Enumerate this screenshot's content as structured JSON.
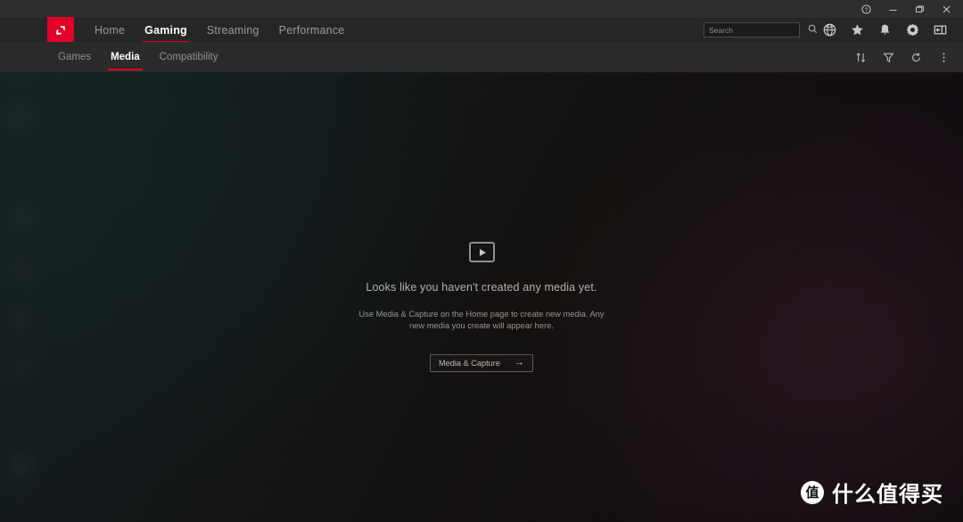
{
  "window": {
    "controls": [
      {
        "name": "help-button",
        "glyph": "?"
      },
      {
        "name": "minimize-button",
        "glyph": "minimize"
      },
      {
        "name": "restore-button",
        "glyph": "restore"
      },
      {
        "name": "close-button",
        "glyph": "close"
      }
    ]
  },
  "brand": {
    "logo_name": "amd-logo",
    "logo_color": "#e00029"
  },
  "mainnav": {
    "items": [
      {
        "label": "Home",
        "active": false
      },
      {
        "label": "Gaming",
        "active": true
      },
      {
        "label": "Streaming",
        "active": false
      },
      {
        "label": "Performance",
        "active": false
      }
    ],
    "accent_color": "#e00029"
  },
  "search": {
    "value": "",
    "placeholder": "Search",
    "icon": "search-icon"
  },
  "toolbar_icons": [
    {
      "name": "globe-icon"
    },
    {
      "name": "star-icon"
    },
    {
      "name": "bell-icon"
    },
    {
      "name": "gear-icon"
    },
    {
      "name": "panel-icon"
    }
  ],
  "subnav": {
    "items": [
      {
        "label": "Games",
        "active": false
      },
      {
        "label": "Media",
        "active": true
      },
      {
        "label": "Compatibility",
        "active": false
      }
    ],
    "icons": [
      {
        "name": "sort-icon"
      },
      {
        "name": "filter-icon"
      },
      {
        "name": "refresh-icon"
      },
      {
        "name": "more-options-icon"
      }
    ]
  },
  "empty_state": {
    "icon": "media-play-icon",
    "headline": "Looks like you haven't created any media yet.",
    "description": "Use Media & Capture on the Home page to create new media. Any new media you create will appear here.",
    "cta_label": "Media & Capture",
    "cta_arrow": "→"
  },
  "watermark": {
    "mark": "值",
    "text": "什么值得买"
  }
}
